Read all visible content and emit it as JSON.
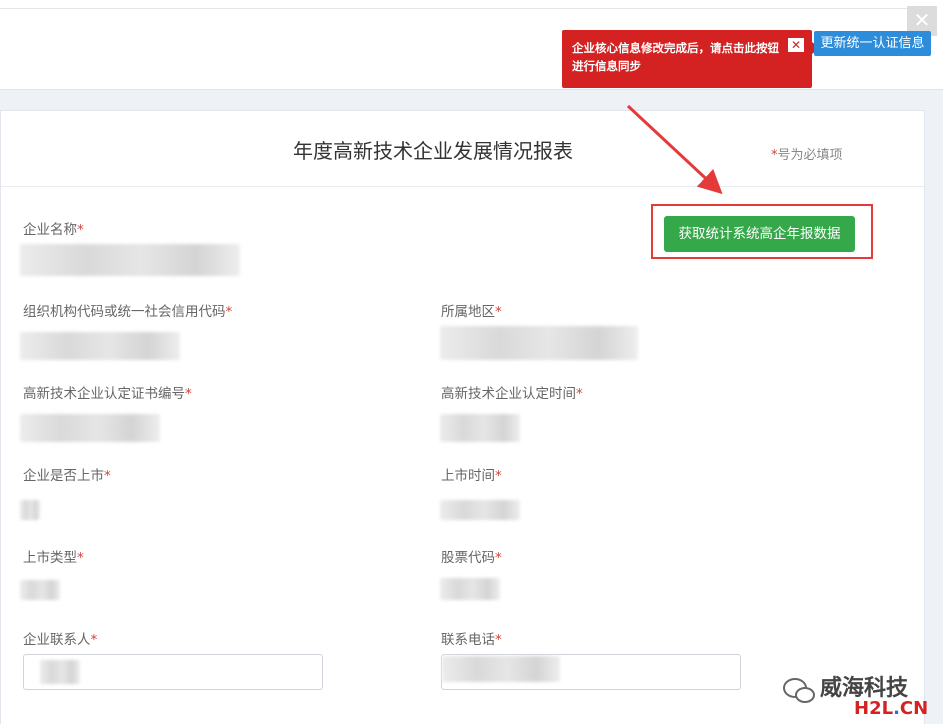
{
  "window": {
    "close_glyph": "✕"
  },
  "sync_button": {
    "label": "更新统一认证信息"
  },
  "tooltip": {
    "text_line1": "企业核心信息修改完成后，请点击此按钮",
    "text_line2": "进行信息同步",
    "close_glyph": "✕"
  },
  "form": {
    "title": "年度高新技术企业发展情况报表",
    "required_note": "号为必填项",
    "required_star": "*",
    "fetch_button_label": "获取统计系统高企年报数据",
    "fields": {
      "company_name": "企业名称",
      "org_code": "组织机构代码或统一社会信用代码",
      "region": "所属地区",
      "cert_number": "高新技术企业认定证书编号",
      "cert_date": "高新技术企业认定时间",
      "is_listed": "企业是否上市",
      "listing_date": "上市时间",
      "listing_type": "上市类型",
      "stock_code": "股票代码",
      "contact_person": "企业联系人",
      "contact_phone": "联系电话"
    }
  },
  "watermark": {
    "name": "威海科技",
    "domain_h2l": "H2L",
    "domain_dot": ".",
    "domain_cn": "CN"
  },
  "colors": {
    "required_star": "#d43f3a",
    "fetch_button": "#35a84a",
    "sync_button": "#2e8ddb",
    "tooltip": "#d42222"
  }
}
